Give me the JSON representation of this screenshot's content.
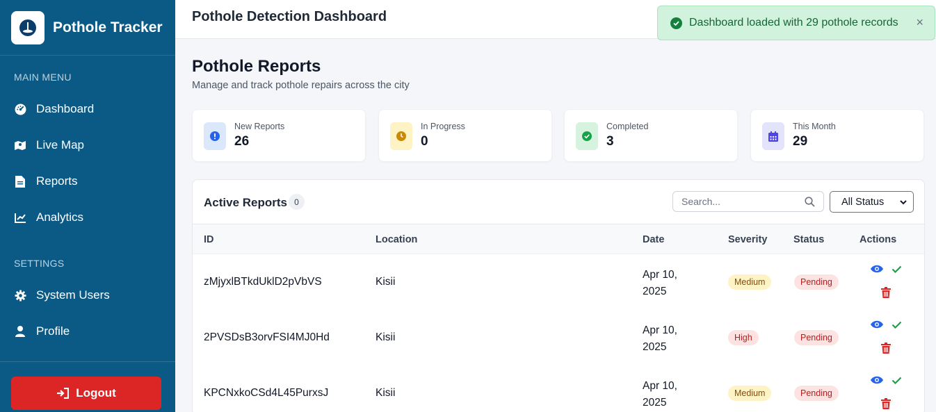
{
  "sidebar": {
    "brand_title": "Pothole Tracker",
    "main_menu_label": "MAIN MENU",
    "settings_label": "SETTINGS",
    "nav": {
      "dashboard": "Dashboard",
      "live_map": "Live Map",
      "reports": "Reports",
      "analytics": "Analytics",
      "system_users": "System Users",
      "profile": "Profile"
    },
    "logout_label": "Logout"
  },
  "header": {
    "title": "Pothole Detection Dashboard"
  },
  "toast": {
    "message": "Dashboard loaded with 29 pothole records",
    "close": "×"
  },
  "page": {
    "title": "Pothole Reports",
    "subtitle": "Manage and track pothole repairs across the city"
  },
  "stats": [
    {
      "label": "New Reports",
      "value": "26",
      "icon": "exclamation-circle-icon",
      "color": "#2563eb"
    },
    {
      "label": "In Progress",
      "value": "0",
      "icon": "clock-icon",
      "color": "#ca8a04"
    },
    {
      "label": "Completed",
      "value": "3",
      "icon": "check-circle-icon",
      "color": "#16a34a"
    },
    {
      "label": "This Month",
      "value": "29",
      "icon": "calendar-icon",
      "color": "#4f46e5"
    }
  ],
  "reports": {
    "title": "Active Reports",
    "count": "0",
    "search_placeholder": "Search...",
    "status_filter": "All Status",
    "columns": [
      "ID",
      "Location",
      "Date",
      "Severity",
      "Status",
      "Actions"
    ],
    "rows": [
      {
        "id": "zMjyxlBTkdUklD2pVbVS",
        "location": "Kisii",
        "date": "Apr 10, 2025",
        "severity": "Medium",
        "status": "Pending"
      },
      {
        "id": "2PVSDsB3orvFSI4MJ0Hd",
        "location": "Kisii",
        "date": "Apr 10, 2025",
        "severity": "High",
        "status": "Pending"
      },
      {
        "id": "KPCNxkoCSd4L45PurxsJ",
        "location": "Kisii",
        "date": "Apr 10, 2025",
        "severity": "Medium",
        "status": "Pending"
      }
    ]
  },
  "colors": {
    "sidebar": "#0b5a86",
    "logout": "#dc2626",
    "medium_badge_bg": "#fdf3c4",
    "high_badge_bg": "#fde2e2",
    "pending_badge_bg": "#fde2e2"
  }
}
